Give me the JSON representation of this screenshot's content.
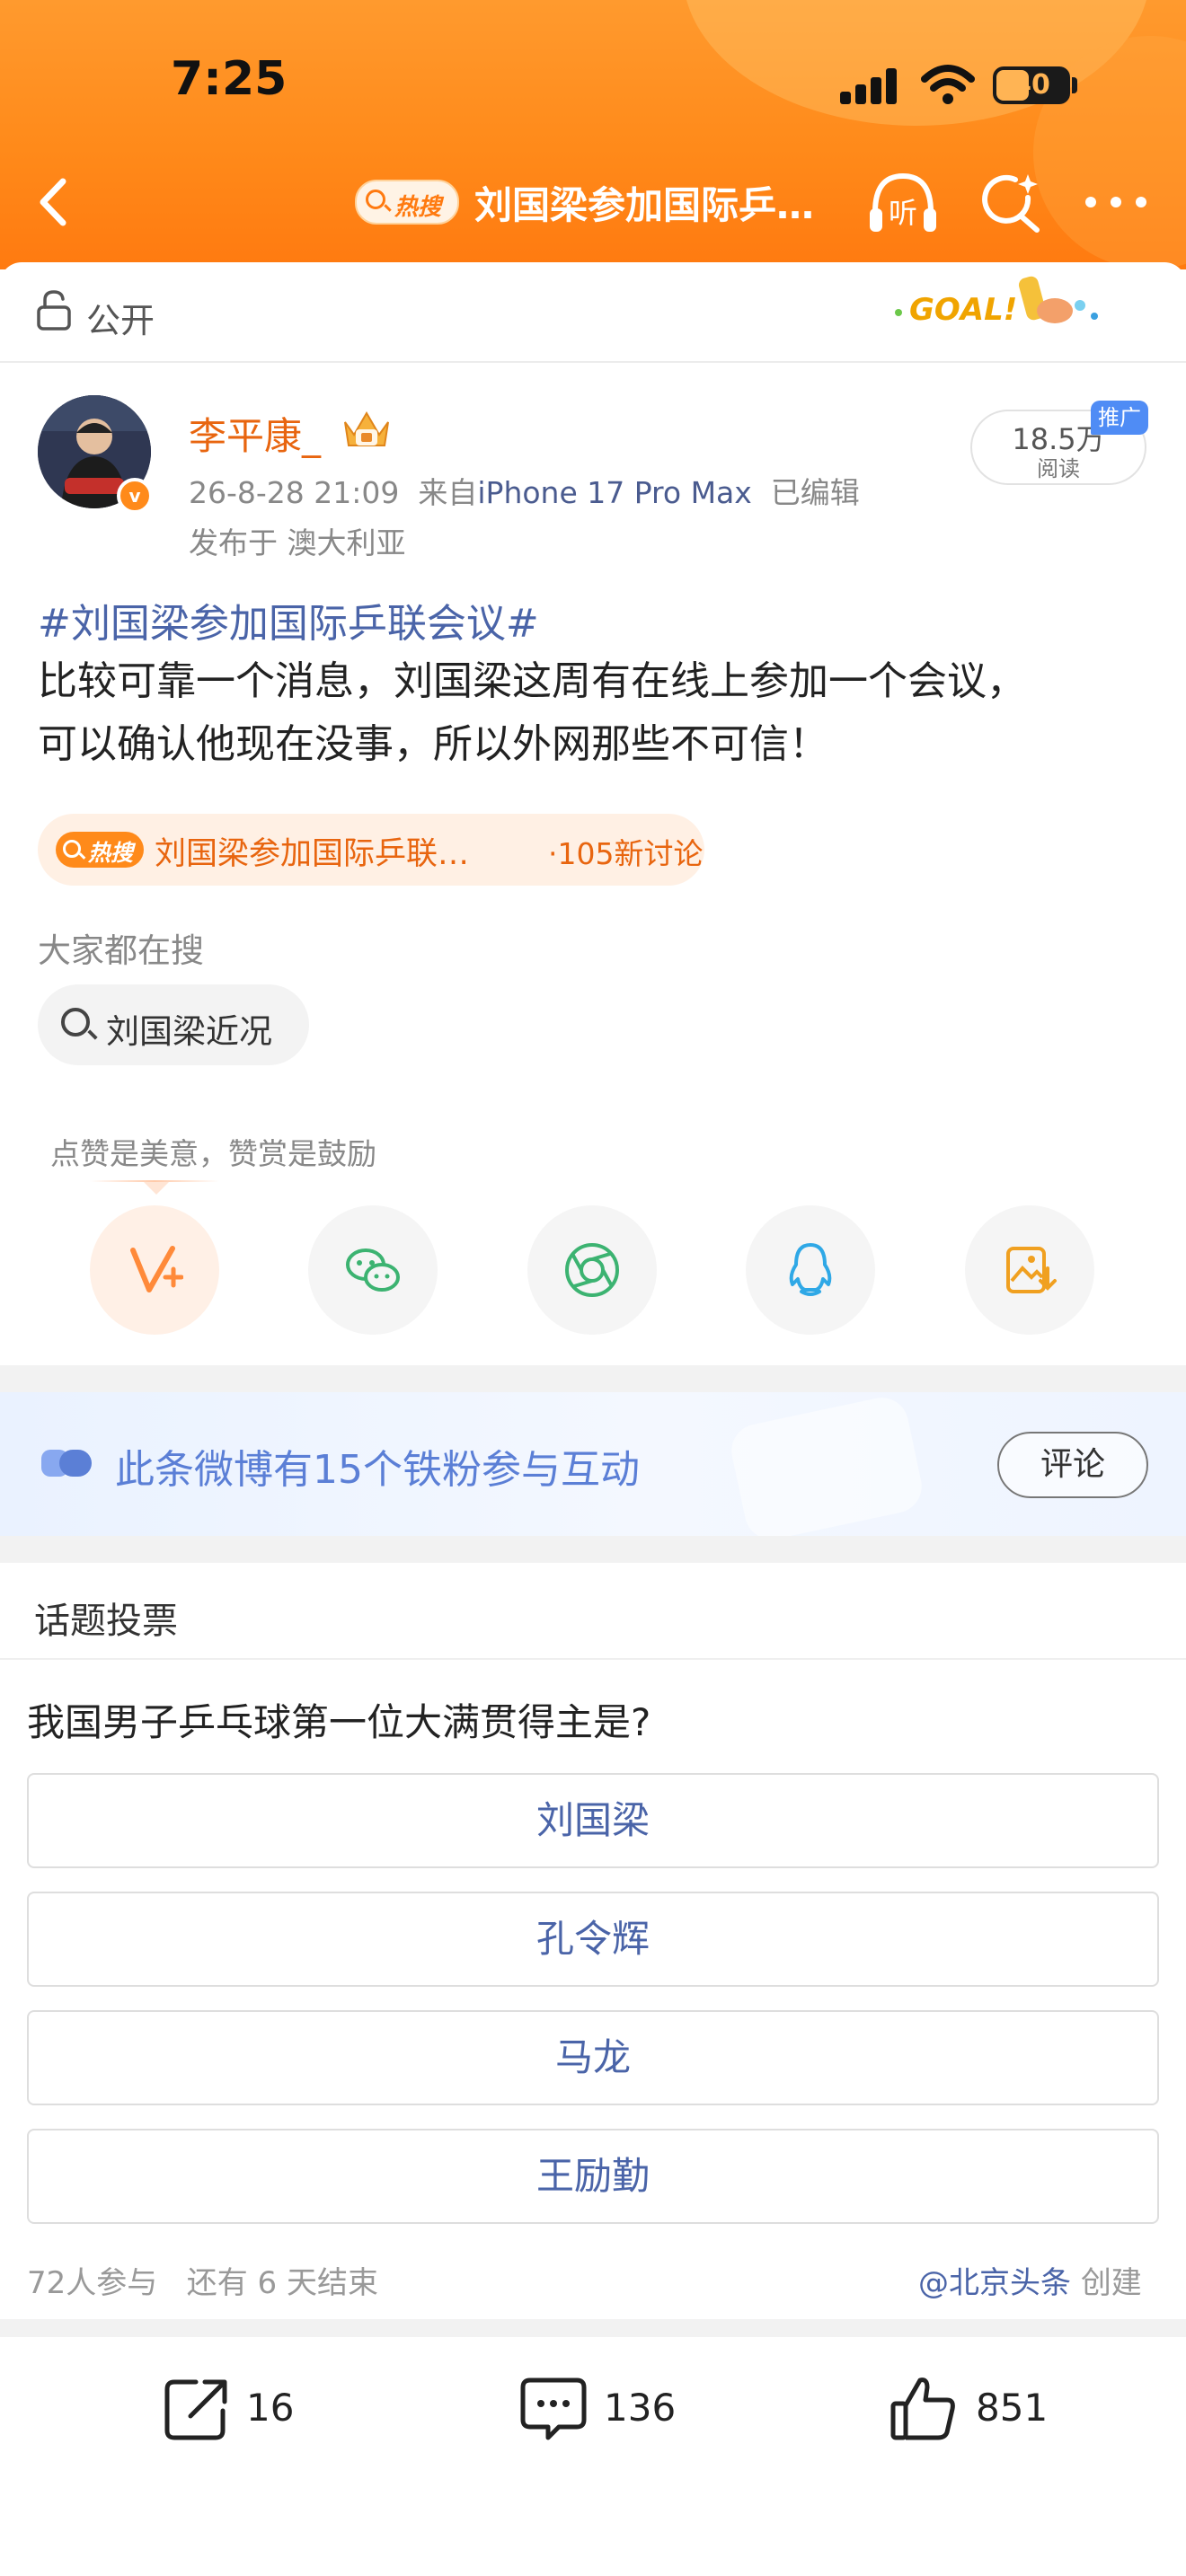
{
  "status_bar": {
    "time": "7:25",
    "battery": "40"
  },
  "header": {
    "hot_badge": "热搜",
    "title": "刘国梁参加国际乒…",
    "listen_label": "听"
  },
  "visibility": {
    "label": "公开",
    "logo_text": "GOAL!"
  },
  "post": {
    "author": "李平康_",
    "verified_mark": "v",
    "date": "26-8-28 21:09",
    "source_prefix": "来自",
    "device": "iPhone 17 Pro Max",
    "edited": "已编辑",
    "location": "发布于 澳大利亚",
    "reads": "18.5万",
    "reads_label": "阅读",
    "promo": "推广",
    "hashtag": "#刘国梁参加国际乒联会议#",
    "body_line1": "比较可靠一个消息，刘国梁这周有在线上参加一个会议，",
    "body_line2": "可以确认他现在没事，所以外网那些不可信！",
    "hot_topic": {
      "badge": "热搜",
      "topic": "刘国梁参加国际乒联…",
      "discussions": "·105新讨论"
    },
    "searching_label": "大家都在搜",
    "search_chip": "刘国梁近况"
  },
  "reward_tip": "点赞是美意，赞赏是鼓励",
  "share_targets": [
    "weibo-reward",
    "wechat",
    "moments",
    "qq",
    "save-image"
  ],
  "fans": {
    "text": "此条微博有15个铁粉参与互动",
    "comment_button": "评论"
  },
  "poll": {
    "title": "话题投票",
    "question": "我国男子乒乓球第一位大满贯得主是?",
    "options": [
      "刘国梁",
      "孔令辉",
      "马龙",
      "王励勤"
    ],
    "participants": "72人参与",
    "remaining": "还有 6 天结束",
    "creator_handle": "@北京头条",
    "creator_suffix": "创建"
  },
  "actions": {
    "reposts": "16",
    "comments": "136",
    "likes": "851"
  },
  "colors": {
    "orange": "#ff8a1a",
    "link_blue": "#4a64a8",
    "fans_blue": "#5b7fd6"
  }
}
